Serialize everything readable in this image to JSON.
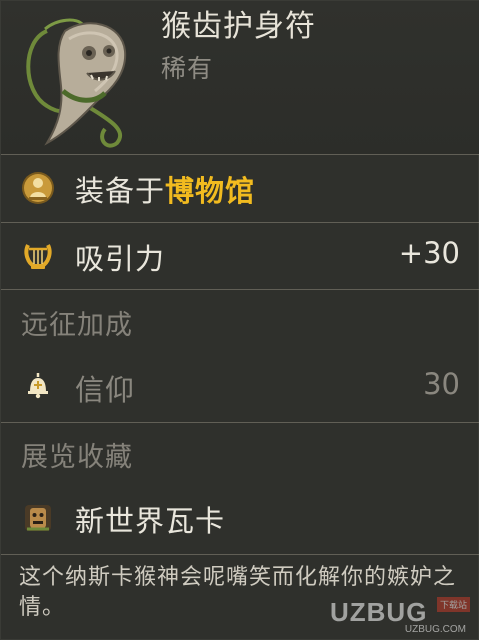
{
  "item": {
    "name": "猴齿护身符",
    "rarity": "稀有",
    "icon": "monkey-tooth-amulet-icon"
  },
  "museum": {
    "prefix": "装备于",
    "place": "博物馆",
    "icon": "bust-icon"
  },
  "attraction": {
    "label": "吸引力",
    "value": "+30",
    "icon": "lyre-icon"
  },
  "expedition": {
    "title": "远征加成",
    "faith_label": "信仰",
    "faith_value": "30",
    "faith_icon": "bell-icon"
  },
  "collection": {
    "title": "展览收藏",
    "name": "新世界瓦卡",
    "icon": "totem-icon"
  },
  "description": "这个纳斯卡猴神会呢嘴笑而化解你的嫉妒之情。",
  "watermark": {
    "text": "UZBUG",
    "badge": "下载站",
    "sub": "UZBUG.COM"
  },
  "colors": {
    "background": "#2f302c",
    "highlight": "#f2bb1f",
    "text": "#e9e6dc",
    "muted": "#85827a"
  }
}
